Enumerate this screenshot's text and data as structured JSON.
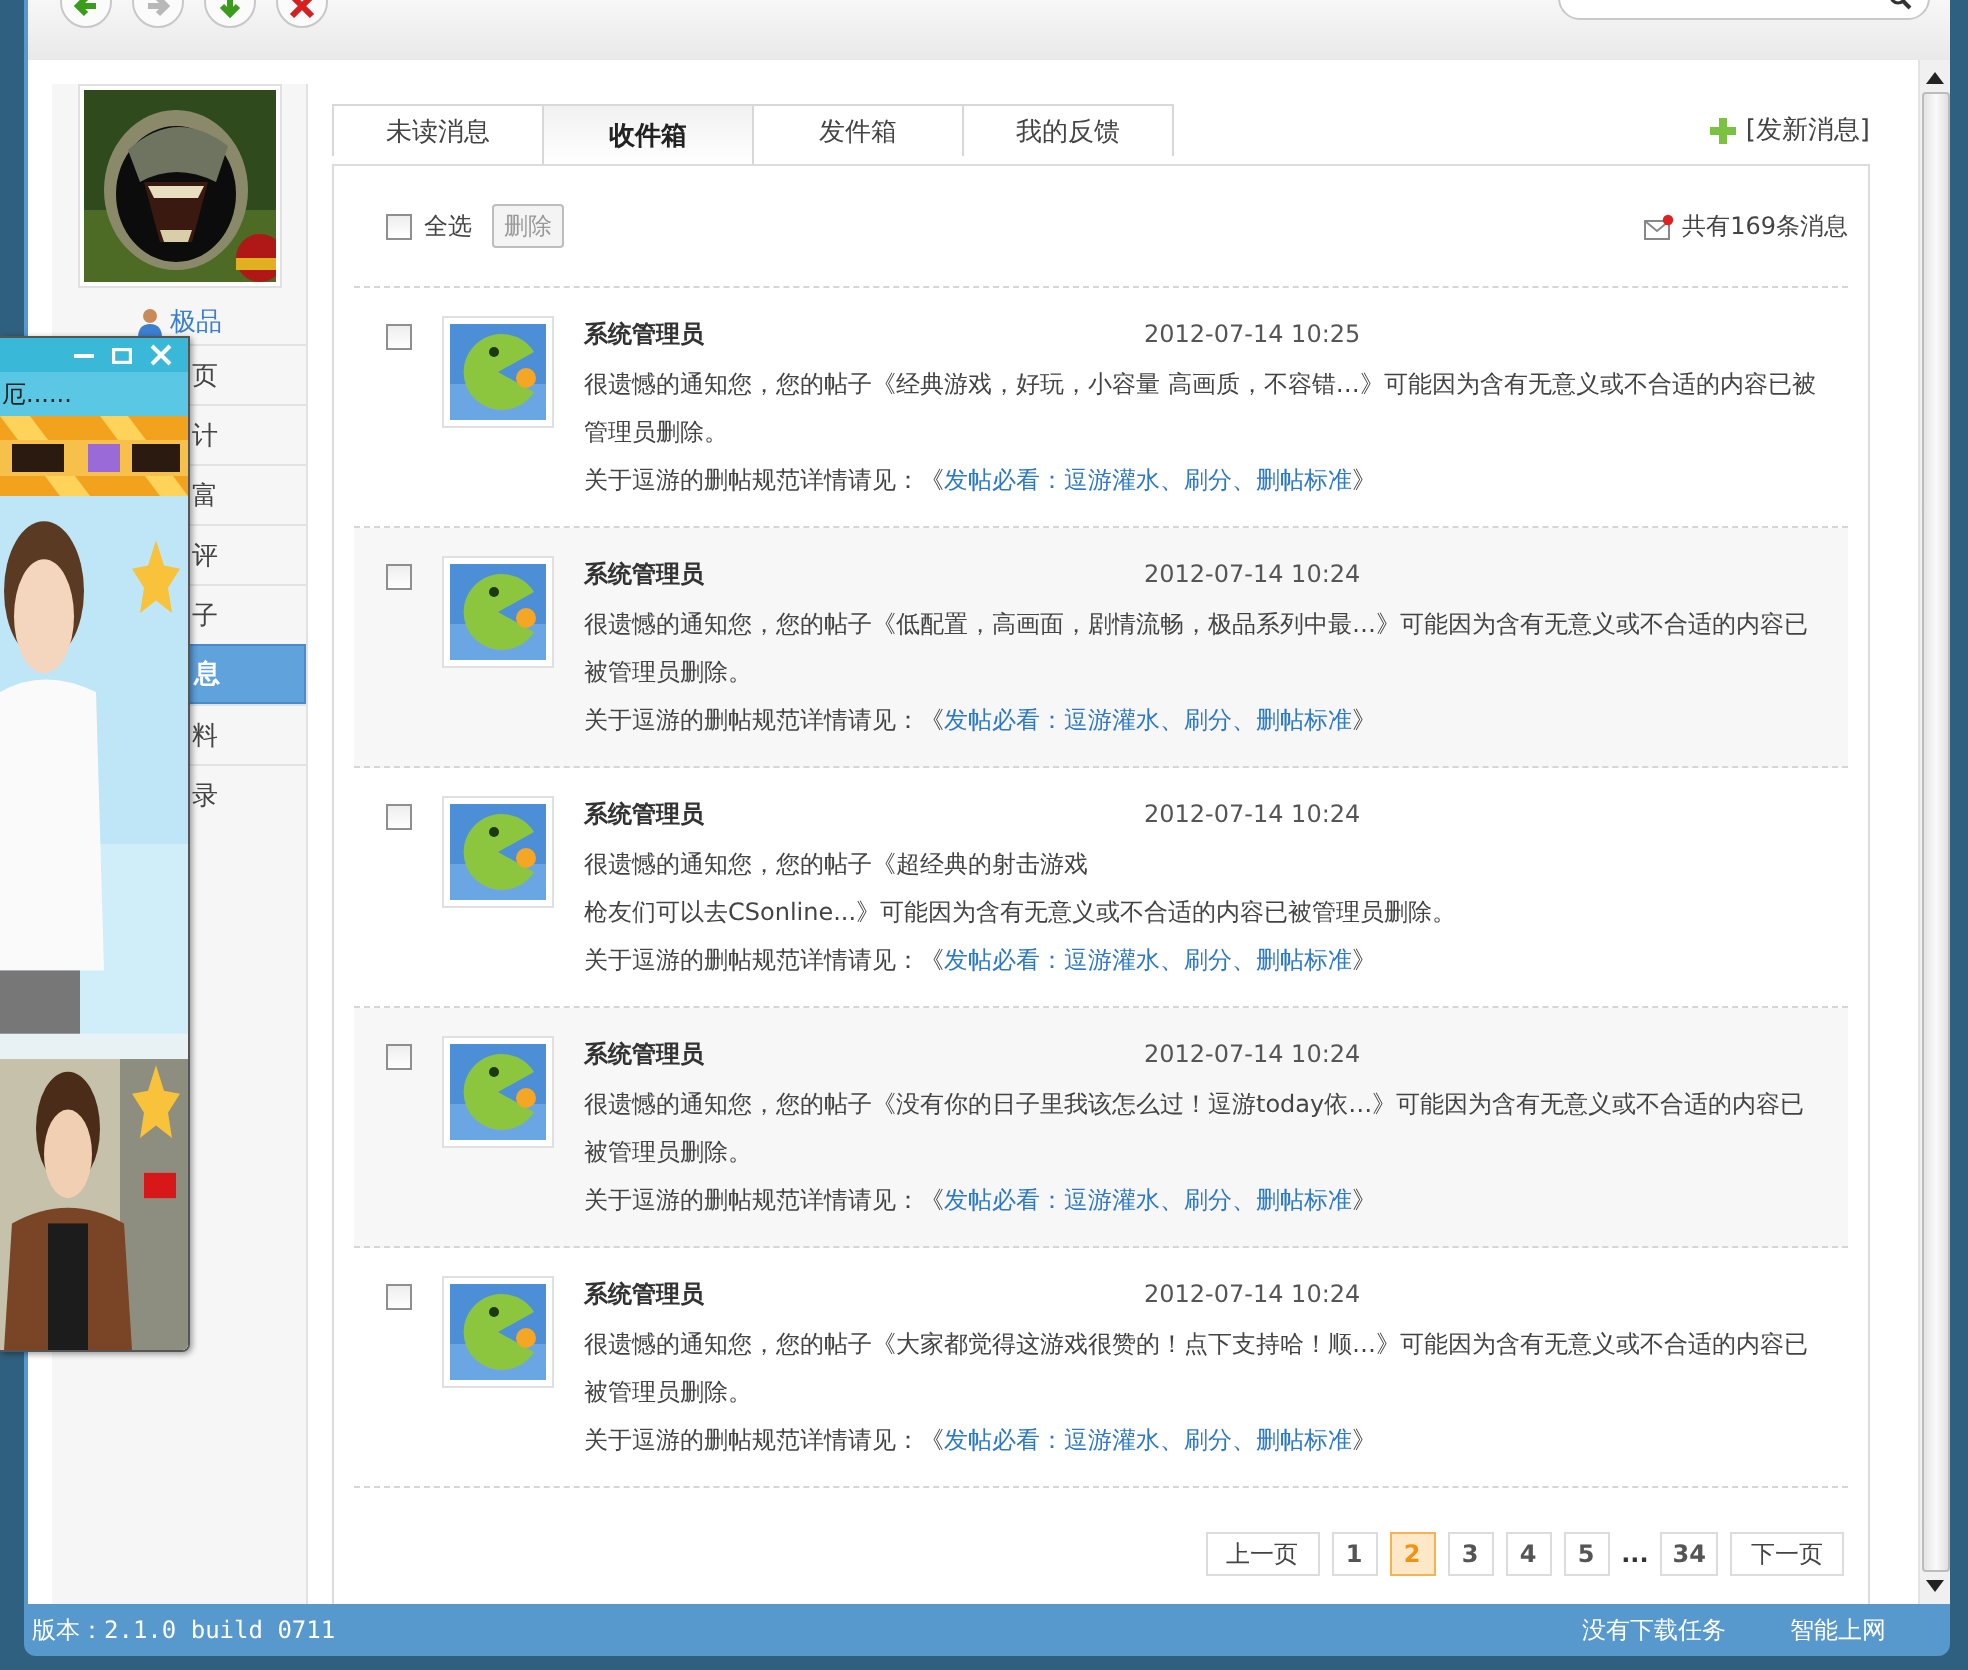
{
  "sidebar": {
    "username": "极品",
    "items": [
      {
        "label": "页",
        "selected": false
      },
      {
        "label": "计",
        "selected": false
      },
      {
        "label": "富",
        "selected": false
      },
      {
        "label": "评",
        "selected": false
      },
      {
        "label": "子",
        "selected": false
      },
      {
        "label": "息",
        "selected": true
      },
      {
        "label": "料",
        "selected": false
      },
      {
        "label": "录",
        "selected": false
      }
    ]
  },
  "popup": {
    "ticker": "厄......"
  },
  "tabs": [
    {
      "label": "未读消息",
      "selected": false
    },
    {
      "label": "收件箱",
      "selected": true
    },
    {
      "label": "发件箱",
      "selected": false
    },
    {
      "label": "我的反馈",
      "selected": false
    }
  ],
  "new_message": "[发新消息]",
  "toolbar": {
    "select_all": {
      "label": "全选",
      "checked": false
    },
    "delete": "删除",
    "total": "共有169条消息"
  },
  "messages": [
    {
      "checked": false,
      "sender": "系统管理员",
      "time": "2012-07-14 10:25",
      "body": "很遗憾的通知您，您的帖子《经典游戏，好玩，小容量  高画质，不容错…》可能因为含有无意义或不合适的内容已被管理员删除。",
      "policy": "关于逗游的删帖规范详情请见：《",
      "link": "发帖必看：逗游灌水、刷分、删帖标准",
      "policy_end": "》"
    },
    {
      "checked": false,
      "sender": "系统管理员",
      "time": "2012-07-14 10:24",
      "body": "很遗憾的通知您，您的帖子《低配置，高画面，剧情流畅，极品系列中最…》可能因为含有无意义或不合适的内容已被管理员删除。",
      "policy": "关于逗游的删帖规范详情请见：《",
      "link": "发帖必看：逗游灌水、刷分、删帖标准",
      "policy_end": "》"
    },
    {
      "checked": false,
      "sender": "系统管理员",
      "time": "2012-07-14 10:24",
      "body": "很遗憾的通知您，您的帖子《超经典的射击游戏",
      "body_2": "枪友们可以去CSonline...》可能因为含有无意义或不合适的内容已被管理员删除。",
      "policy": "关于逗游的删帖规范详情请见：《",
      "link": "发帖必看：逗游灌水、刷分、删帖标准",
      "policy_end": "》"
    },
    {
      "checked": false,
      "sender": "系统管理员",
      "time": "2012-07-14 10:24",
      "body": "很遗憾的通知您，您的帖子《没有你的日子里我该怎么过！逗游today依…》可能因为含有无意义或不合适的内容已被管理员删除。",
      "policy": "关于逗游的删帖规范详情请见：《",
      "link": "发帖必看：逗游灌水、刷分、删帖标准",
      "policy_end": "》"
    },
    {
      "checked": false,
      "sender": "系统管理员",
      "time": "2012-07-14 10:24",
      "body": "很遗憾的通知您，您的帖子《大家都觉得这游戏很赞的！点下支持哈！顺…》可能因为含有无意义或不合适的内容已被管理员删除。",
      "policy": "关于逗游的删帖规范详情请见：《",
      "link": "发帖必看：逗游灌水、刷分、删帖标准",
      "policy_end": "》"
    }
  ],
  "pagination": {
    "prev": "上一页",
    "next": "下一页",
    "ellipsis": "...",
    "pages": [
      {
        "label": "1",
        "selected": false
      },
      {
        "label": "2",
        "selected": true
      },
      {
        "label": "3",
        "selected": false
      },
      {
        "label": "4",
        "selected": false
      },
      {
        "label": "5",
        "selected": false
      },
      {
        "label": "34",
        "selected": false
      }
    ]
  },
  "status_bar": {
    "version": "版本：2.1.0 build 0711",
    "downloads": "没有下载任务",
    "mode": "智能上网"
  }
}
